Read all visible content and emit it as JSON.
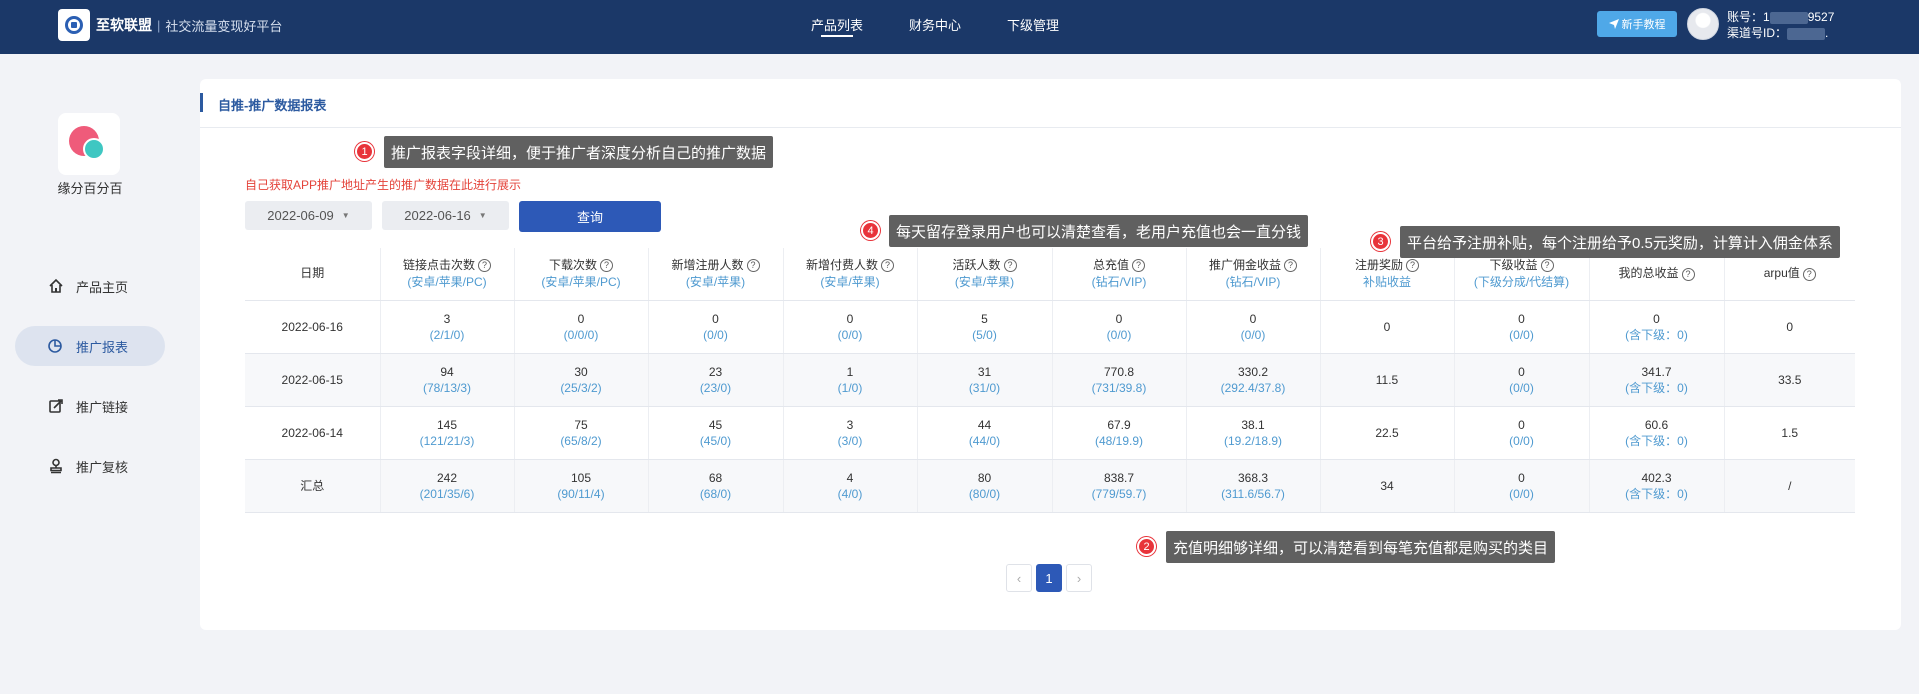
{
  "brand": {
    "name": "至软联盟",
    "separator": "|",
    "slogan": "社交流量变现好平台"
  },
  "nav": [
    {
      "label": "产品列表",
      "active": true
    },
    {
      "label": "财务中心",
      "active": false
    },
    {
      "label": "下级管理",
      "active": false
    }
  ],
  "header": {
    "guide_label": "新手教程",
    "account_label": "账号：1",
    "account_tail": "9527",
    "channel_label": "渠道号ID：",
    "channel_tail": "."
  },
  "app": {
    "name": "缘分百分百"
  },
  "sidebar": {
    "items": [
      {
        "label": "产品主页",
        "icon": "home-icon"
      },
      {
        "label": "推广报表",
        "icon": "chart-icon",
        "active": true
      },
      {
        "label": "推广链接",
        "icon": "link-icon"
      },
      {
        "label": "推广复核",
        "icon": "stamp-icon"
      }
    ]
  },
  "page": {
    "title": "自推-推广数据报表",
    "hint": "自己获取APP推广地址产生的推广数据在此进行展示"
  },
  "filters": {
    "start_date": "2022-06-09",
    "end_date": "2022-06-16",
    "query_label": "查询"
  },
  "table": {
    "columns": [
      {
        "label": "日期",
        "sub": "",
        "help": false
      },
      {
        "label": "链接点击次数",
        "sub": "(安卓/苹果/PC)",
        "help": true
      },
      {
        "label": "下载次数",
        "sub": "(安卓/苹果/PC)",
        "help": true
      },
      {
        "label": "新增注册人数",
        "sub": "(安卓/苹果)",
        "help": true
      },
      {
        "label": "新增付费人数",
        "sub": "(安卓/苹果)",
        "help": true
      },
      {
        "label": "活跃人数",
        "sub": "(安卓/苹果)",
        "help": true
      },
      {
        "label": "总充值",
        "sub": "(钻石/VIP)",
        "help": true
      },
      {
        "label": "推广佣金收益",
        "sub": "(钻石/VIP)",
        "help": true
      },
      {
        "label": "注册奖励",
        "sub": "补贴收益",
        "help": true
      },
      {
        "label": "下级收益",
        "sub": "(下级分成/代结算)",
        "help": true
      },
      {
        "label": "我的总收益",
        "sub": "",
        "help": true
      },
      {
        "label": "arpu值",
        "sub": "",
        "help": true
      }
    ],
    "rows": [
      {
        "date": "2022-06-16",
        "cells": [
          [
            "3",
            "(2/1/0)"
          ],
          [
            "0",
            "(0/0/0)"
          ],
          [
            "0",
            "(0/0)"
          ],
          [
            "0",
            "(0/0)"
          ],
          [
            "5",
            "(5/0)"
          ],
          [
            "0",
            "(0/0)"
          ],
          [
            "0",
            "(0/0)"
          ],
          [
            "0",
            ""
          ],
          [
            "0",
            "(0/0)"
          ],
          [
            "0",
            "(含下级：0)"
          ],
          [
            "0",
            ""
          ]
        ]
      },
      {
        "date": "2022-06-15",
        "cells": [
          [
            "94",
            "(78/13/3)"
          ],
          [
            "30",
            "(25/3/2)"
          ],
          [
            "23",
            "(23/0)"
          ],
          [
            "1",
            "(1/0)"
          ],
          [
            "31",
            "(31/0)"
          ],
          [
            "770.8",
            "(731/39.8)"
          ],
          [
            "330.2",
            "(292.4/37.8)"
          ],
          [
            "11.5",
            ""
          ],
          [
            "0",
            "(0/0)"
          ],
          [
            "341.7",
            "(含下级：0)"
          ],
          [
            "33.5",
            ""
          ]
        ]
      },
      {
        "date": "2022-06-14",
        "cells": [
          [
            "145",
            "(121/21/3)"
          ],
          [
            "75",
            "(65/8/2)"
          ],
          [
            "45",
            "(45/0)"
          ],
          [
            "3",
            "(3/0)"
          ],
          [
            "44",
            "(44/0)"
          ],
          [
            "67.9",
            "(48/19.9)"
          ],
          [
            "38.1",
            "(19.2/18.9)"
          ],
          [
            "22.5",
            ""
          ],
          [
            "0",
            "(0/0)"
          ],
          [
            "60.6",
            "(含下级：0)"
          ],
          [
            "1.5",
            ""
          ]
        ]
      },
      {
        "date": "汇总",
        "cells": [
          [
            "242",
            "(201/35/6)"
          ],
          [
            "105",
            "(90/11/4)"
          ],
          [
            "68",
            "(68/0)"
          ],
          [
            "4",
            "(4/0)"
          ],
          [
            "80",
            "(80/0)"
          ],
          [
            "838.7",
            "(779/59.7)"
          ],
          [
            "368.3",
            "(311.6/56.7)"
          ],
          [
            "34",
            ""
          ],
          [
            "0",
            "(0/0)"
          ],
          [
            "402.3",
            "(含下级：0)"
          ],
          [
            "/",
            ""
          ]
        ]
      }
    ]
  },
  "pagination": {
    "prev": "‹",
    "current": "1",
    "next": "›"
  },
  "annotations": [
    {
      "num": "1",
      "text": "推广报表字段详细，便于推广者深度分析自己的推广数据"
    },
    {
      "num": "4",
      "text": "每天留存登录用户也可以清楚查看，老用户充值也会一直分钱"
    },
    {
      "num": "3",
      "text": "平台给予注册补贴，每个注册给予0.5元奖励，计算计入佣金体系"
    },
    {
      "num": "2",
      "text": "充值明细够详细，可以清楚看到每笔充值都是购买的类目"
    }
  ]
}
